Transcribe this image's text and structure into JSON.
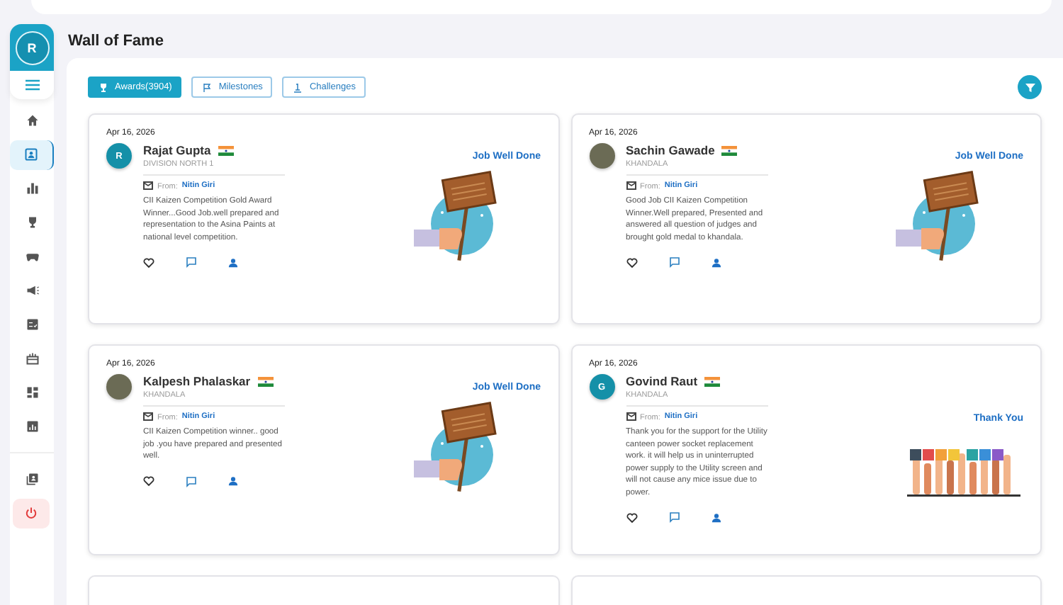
{
  "page": {
    "title": "Wall of Fame"
  },
  "profile": {
    "initial": "R"
  },
  "sidebar": {
    "nav_items": [
      {
        "selected": false
      },
      {
        "selected": true
      },
      {
        "selected": false
      },
      {
        "selected": false
      },
      {
        "selected": false
      },
      {
        "selected": false
      },
      {
        "selected": false
      },
      {
        "selected": false
      },
      {
        "selected": false
      },
      {
        "selected": false
      }
    ],
    "footer_items": [
      {
        "kind": "directory"
      },
      {
        "kind": "logout"
      }
    ]
  },
  "tabs": [
    {
      "label": "Awards(3904)",
      "selected": true
    },
    {
      "label": "Milestones",
      "selected": false
    },
    {
      "label": "Challenges",
      "selected": false
    }
  ],
  "cards": [
    {
      "date": "Apr 16, 2026",
      "name": "Rajat Gupta",
      "location": "DIVISION NORTH 1",
      "avatar": {
        "kind": "initial",
        "initial": "R"
      },
      "from_label": "From:",
      "from_name": "Nitin Giri",
      "message": "CII Kaizen Competition Gold Award Winner...Good Job.well prepared and representation to the Asina Paints at national level competition.",
      "award": "Job Well Done",
      "illustration": {
        "kind": "sign"
      }
    },
    {
      "date": "Apr 16, 2026",
      "name": "Sachin Gawade",
      "location": "KHANDALA",
      "avatar": {
        "kind": "photo"
      },
      "from_label": "From:",
      "from_name": "Nitin Giri",
      "message": "Good Job CII Kaizen Competition Winner.Well prepared, Presented and answered all question of judges and brought gold medal to khandala.",
      "award": "Job Well Done",
      "illustration": {
        "kind": "sign"
      }
    },
    {
      "date": "Apr 16, 2026",
      "name": "Kalpesh Phalaskar",
      "location": "KHANDALA",
      "avatar": {
        "kind": "photo"
      },
      "from_label": "From:",
      "from_name": "Nitin Giri",
      "message": "CII Kaizen Competition winner.. good job .you have prepared and presented well.",
      "award": "Job Well Done",
      "illustration": {
        "kind": "sign"
      }
    },
    {
      "date": "Apr 16, 2026",
      "name": "Govind Raut",
      "location": "KHANDALA",
      "avatar": {
        "kind": "initial",
        "initial": "G"
      },
      "from_label": "From:",
      "from_name": "Nitin Giri",
      "message": "Thank you for the support for the Utility canteen power socket replacement work. it will help us in uninterrupted power supply to the Utility screen and will not cause any mice issue due to power.",
      "award": "Thank You",
      "illustration": {
        "kind": "hands"
      }
    }
  ]
}
